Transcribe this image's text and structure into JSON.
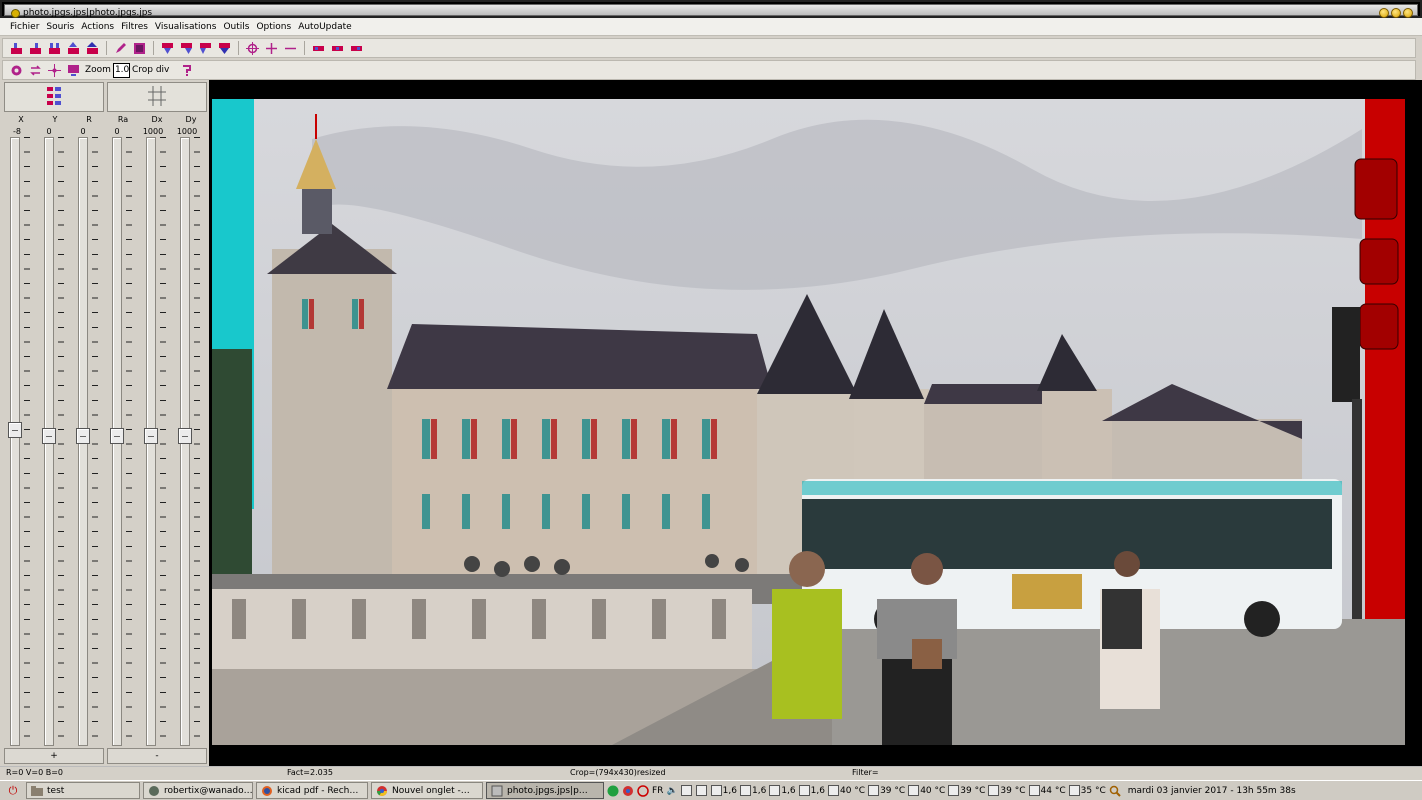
{
  "window": {
    "title": "photo.jpgs.jps|photo.jpgs.jps"
  },
  "menu": [
    "Fichier",
    "Souris",
    "Actions",
    "Filtres",
    "Visualisations",
    "Outils",
    "Options",
    "AutoUpdate"
  ],
  "toolbar2": {
    "zoom_label": "Zoom",
    "zoom_value": "1.0",
    "crop_label": "Crop div"
  },
  "sliders": {
    "columns": [
      {
        "label": "X",
        "value": "-8",
        "level": 0.48
      },
      {
        "label": "Y",
        "value": "0",
        "level": 0.49
      },
      {
        "label": "R",
        "value": "0",
        "level": 0.49
      },
      {
        "label": "Ra",
        "value": "0",
        "level": 0.49
      },
      {
        "label": "Dx",
        "value": "1000",
        "level": 0.49
      },
      {
        "label": "Dy",
        "value": "1000",
        "level": 0.49
      }
    ],
    "plus_label": "+",
    "minus_label": "-"
  },
  "status": {
    "rvb": "R=0 V=0 B=0",
    "fact": "Fact=2.035",
    "crop": "Crop=(794x430)resized",
    "filter": "Filter="
  },
  "taskbar": {
    "tasks": [
      {
        "label": "test",
        "icon": "folder-icon"
      },
      {
        "label": "robertix@wanado…",
        "icon": "mail-icon"
      },
      {
        "label": "kicad pdf - Rech…",
        "icon": "firefox-icon"
      },
      {
        "label": "Nouvel onglet -…",
        "icon": "chrome-icon"
      },
      {
        "label": "photo.jpgs.jps|p…",
        "icon": "app-icon",
        "active": true
      }
    ],
    "lang": "FR",
    "monitors": [
      "1,6",
      "1,6",
      "1,6",
      "1,6"
    ],
    "temps": [
      "40 °C",
      "39 °C",
      "40 °C",
      "39 °C",
      "39 °C",
      "44 °C",
      "35 °C"
    ],
    "clock": "mardi 03 janvier 2017 - 13h 55m 38s"
  },
  "colors": {
    "cyan": "#18c8cc",
    "red": "#c80000"
  }
}
